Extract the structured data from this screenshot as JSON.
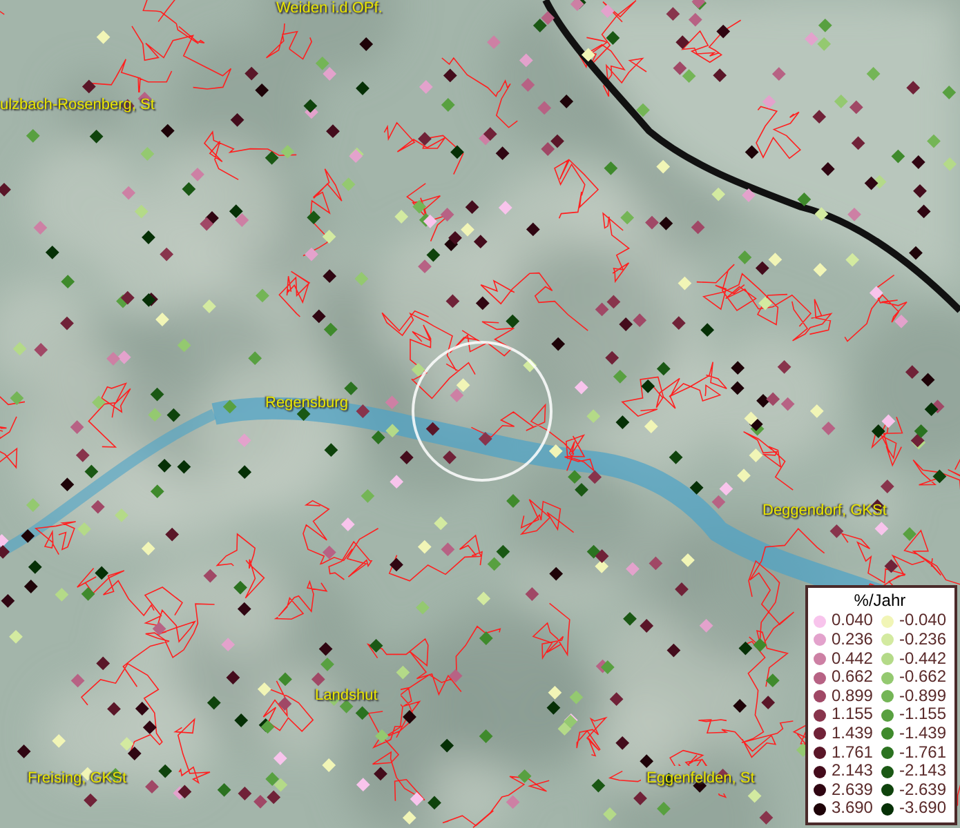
{
  "map_labels": [
    {
      "text": "Weiden i.d.OPf."
    },
    {
      "text": "ulzbach-Rosenberg, St"
    },
    {
      "text": "Regensburg"
    },
    {
      "text": "Deggendorf, GKSt"
    },
    {
      "text": "Landshut"
    },
    {
      "text": "Freising, GKSt"
    },
    {
      "text": "Eggenfelden, St"
    }
  ],
  "legend": {
    "title": "%/Jahr",
    "items": [
      {
        "positive": {
          "label": "0.040",
          "color": "#f8c4ec"
        },
        "negative": {
          "label": "-0.040",
          "color": "#f1f5b6"
        }
      },
      {
        "positive": {
          "label": "0.236",
          "color": "#e3a2cc"
        },
        "negative": {
          "label": "-0.236",
          "color": "#d3eaa0"
        }
      },
      {
        "positive": {
          "label": "0.442",
          "color": "#cd80a4"
        },
        "negative": {
          "label": "-0.442",
          "color": "#b4da88"
        }
      },
      {
        "positive": {
          "label": "0.662",
          "color": "#b76284"
        },
        "negative": {
          "label": "-0.662",
          "color": "#94c970"
        }
      },
      {
        "positive": {
          "label": "0.899",
          "color": "#a04866"
        },
        "negative": {
          "label": "-0.899",
          "color": "#74b556"
        }
      },
      {
        "positive": {
          "label": "1.155",
          "color": "#88344c"
        },
        "negative": {
          "label": "-1.155",
          "color": "#58a040"
        }
      },
      {
        "positive": {
          "label": "1.439",
          "color": "#702238"
        },
        "negative": {
          "label": "-1.439",
          "color": "#3f8a2c"
        }
      },
      {
        "positive": {
          "label": "1.761",
          "color": "#5a1628"
        },
        "negative": {
          "label": "-1.761",
          "color": "#2b7220"
        }
      },
      {
        "positive": {
          "label": "2.143",
          "color": "#440c1c"
        },
        "negative": {
          "label": "-2.143",
          "color": "#1a5814"
        }
      },
      {
        "positive": {
          "label": "2.639",
          "color": "#300612"
        },
        "negative": {
          "label": "-2.639",
          "color": "#0f430c"
        }
      },
      {
        "positive": {
          "label": "3.690",
          "color": "#1e0308"
        },
        "negative": {
          "label": "-3.690",
          "color": "#063006"
        }
      }
    ]
  }
}
